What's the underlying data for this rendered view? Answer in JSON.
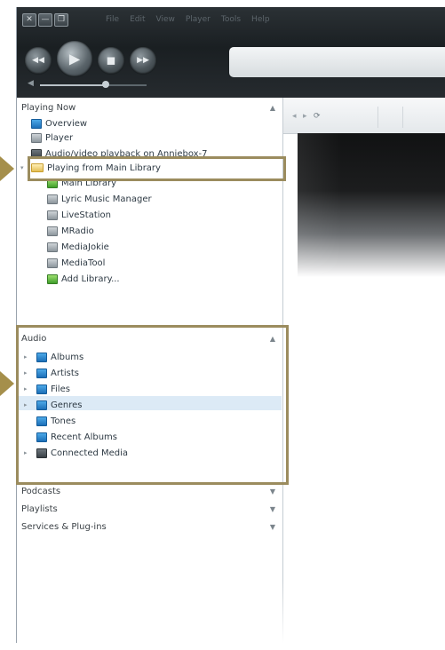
{
  "window": {
    "buttons": [
      "✕",
      "—",
      "❐"
    ],
    "menu": [
      "File",
      "Edit",
      "View",
      "Player",
      "Tools",
      "Help"
    ]
  },
  "transport": {
    "prev_icon": "◀◀",
    "play_icon": "▶",
    "stop_icon": "■",
    "next_icon": "▶▶",
    "volume_icon": "◀",
    "volume_level": 0.62
  },
  "sidebar": {
    "playing_now": {
      "header": "Playing Now",
      "items": [
        {
          "label": "Overview"
        },
        {
          "label": "Player"
        },
        {
          "label": "Audio/video playback on Anniebox-7"
        },
        {
          "label": "Playing from Main Library"
        },
        {
          "label": "Main Library"
        },
        {
          "label": "Lyric Music Manager"
        },
        {
          "label": "LiveStation"
        },
        {
          "label": "MRadio"
        },
        {
          "label": "MediaJokie"
        },
        {
          "label": "MediaTool"
        },
        {
          "label": "Add Library..."
        }
      ]
    },
    "audio": {
      "header": "Audio",
      "items": [
        {
          "label": "Albums"
        },
        {
          "label": "Artists"
        },
        {
          "label": "Files"
        },
        {
          "label": "Genres"
        },
        {
          "label": "Tones"
        },
        {
          "label": "Recent Albums"
        },
        {
          "label": "Connected Media"
        }
      ]
    },
    "other_sections": [
      {
        "label": "Podcasts"
      },
      {
        "label": "Playlists"
      },
      {
        "label": "Services & Plug-ins"
      }
    ]
  },
  "colors": {
    "accent_annotation": "#9b8c5e",
    "selection": "#dceaf6"
  }
}
